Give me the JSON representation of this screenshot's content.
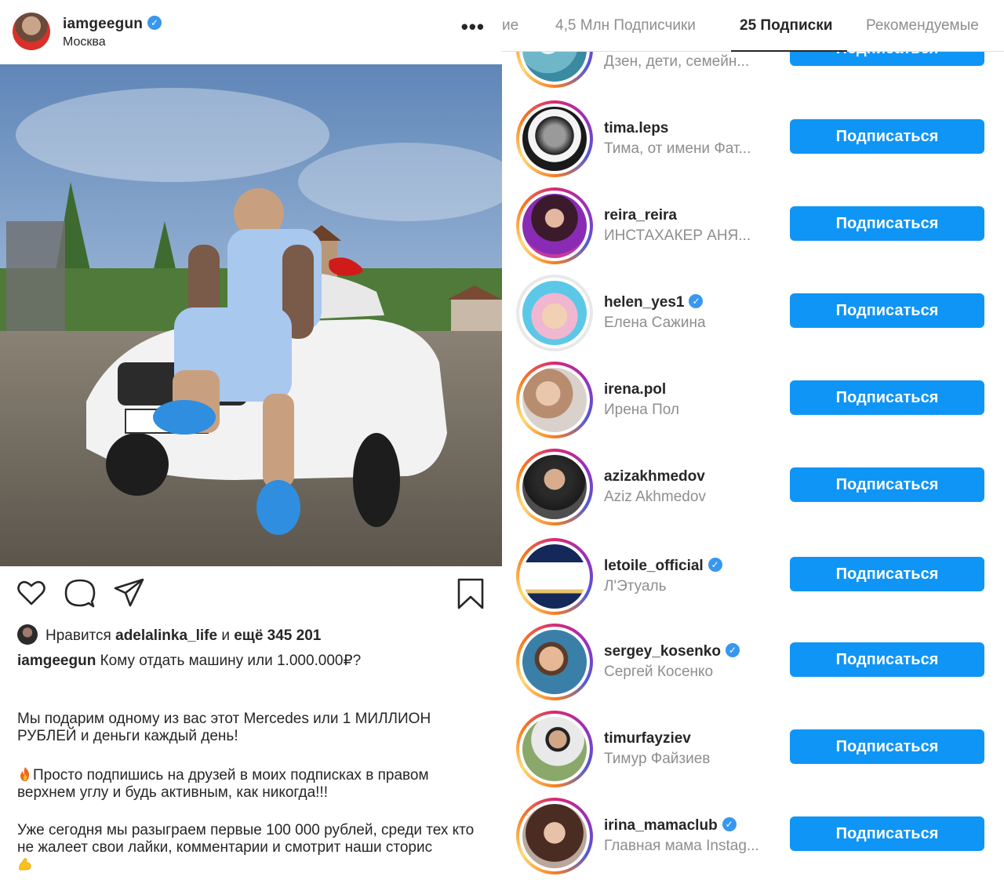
{
  "post": {
    "username": "iamgeegun",
    "location": "Москва",
    "more_icon": "more-dots-icon",
    "likes": {
      "prefix": "Нравится",
      "user": "adelalinka_life",
      "suffix": "и ещё 345 201"
    },
    "caption": {
      "author": "iamgeegun",
      "text": "Кому отдать машину или 1.000.000₽?",
      "p1": "Мы подарим одному из вас этот Mercedes или 1 МИЛЛИОН РУБЛЕЙ и деньги каждый день!",
      "p2": "Просто подпишись на друзей в моих подписках в правом верхнем углу и будь активным, как никогда!!!",
      "p3": "Уже  сегодня мы разыграем первые 100 000 рублей, среди тех кто не жалеет свои лайки, комментарии и смотрит наши сторис"
    }
  },
  "panel": {
    "tabs": [
      {
        "label": "ие"
      },
      {
        "label": "4,5 Млн Подписчики"
      },
      {
        "label": "25 Подписки"
      },
      {
        "label": "Рекомендуемые"
      }
    ],
    "accounts": [
      {
        "username": "",
        "fullname": "Дзен, дети, семейн...",
        "verified": false,
        "button": "Подписаться"
      },
      {
        "username": "tima.leps",
        "fullname": "Тима, от имени Фат...",
        "verified": false,
        "button": "Подписаться"
      },
      {
        "username": "reira_reira",
        "fullname": "ИНСТАХАКЕР АНЯ...",
        "verified": false,
        "button": "Подписаться"
      },
      {
        "username": "helen_yes1",
        "fullname": "Елена Сажина",
        "verified": true,
        "button": "Подписаться"
      },
      {
        "username": "irena.pol",
        "fullname": "Ирена Пол",
        "verified": false,
        "button": "Подписаться"
      },
      {
        "username": "azizakhmedov",
        "fullname": "Aziz Akhmedov",
        "verified": false,
        "button": "Подписаться"
      },
      {
        "username": "letoile_official",
        "fullname": "Л'Этуаль",
        "verified": true,
        "button": "Подписаться"
      },
      {
        "username": "sergey_kosenko",
        "fullname": "Сергей Косенко",
        "verified": true,
        "button": "Подписаться"
      },
      {
        "username": "timurfayziev",
        "fullname": "Тимур Файзиев",
        "verified": false,
        "button": "Подписаться"
      },
      {
        "username": "irina_mamaclub",
        "fullname": "Главная мама Instag...",
        "verified": true,
        "button": "Подписаться"
      }
    ]
  },
  "colors": {
    "follow_button": "#0f95f6",
    "verified_badge": "#3897f0",
    "muted_text": "#8e8e8e"
  }
}
